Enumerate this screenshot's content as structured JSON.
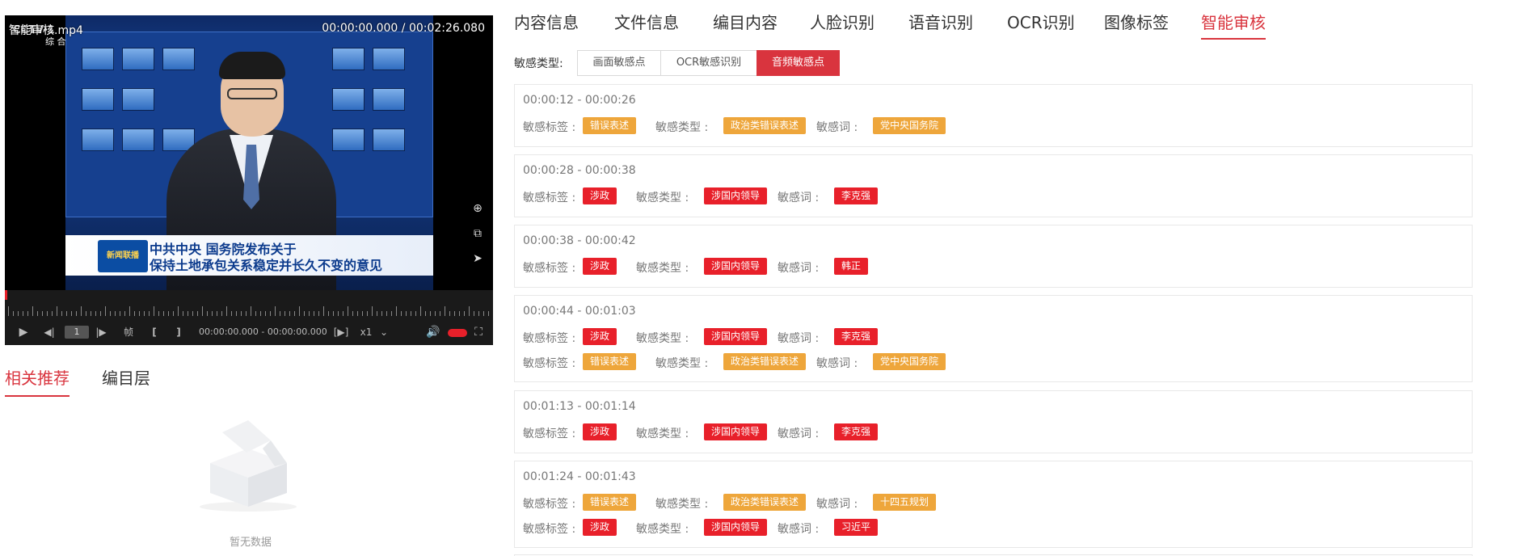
{
  "player": {
    "file_name": "智能审核.mp4",
    "time_display": "00:00:00.000 / 00:02:26.080",
    "channel_logo": "CCTV-1",
    "channel_sub": "综 合",
    "caption_logo": "新闻联播",
    "caption_line1": "中共中央 国务院发布关于",
    "caption_line2": "保持土地承包关系稳定并长久不变的意见",
    "frame_value": "1",
    "frame_label": "帧",
    "in_out_time": "00:00:00.000 - 00:00:00.000",
    "speed": "x1"
  },
  "left_tabs": [
    {
      "label": "相关推荐",
      "active": true
    },
    {
      "label": "编目层",
      "active": false
    }
  ],
  "empty_state": {
    "text": "暂无数据"
  },
  "main_tabs": [
    {
      "label": "内容信息"
    },
    {
      "label": "文件信息"
    },
    {
      "label": "编目内容"
    },
    {
      "label": "人脸识别"
    },
    {
      "label": "语音识别"
    },
    {
      "label": "OCR识别"
    },
    {
      "label": "图像标签"
    },
    {
      "label": "智能审核",
      "active": true
    }
  ],
  "filter": {
    "label": "敏感类型:",
    "options": [
      "画面敏感点",
      "OCR敏感识别",
      "音频敏感点"
    ],
    "selected": "音频敏感点"
  },
  "field_labels": {
    "tag": "敏感标签 :",
    "type": "敏感类型 :",
    "word": "敏感词 :"
  },
  "colors": {
    "accent": "#d9343e",
    "tag_orange": "#eea63b",
    "tag_red": "#e8202a"
  },
  "results": [
    {
      "time": "00:00:12 - 00:00:26",
      "rows": [
        {
          "tag": "错误表述",
          "type": "政治类错误表述",
          "word": "党中央国务院",
          "color": "orange"
        }
      ]
    },
    {
      "time": "00:00:28 - 00:00:38",
      "rows": [
        {
          "tag": "涉政",
          "type": "涉国内领导",
          "word": "李克强",
          "color": "red"
        }
      ]
    },
    {
      "time": "00:00:38 - 00:00:42",
      "rows": [
        {
          "tag": "涉政",
          "type": "涉国内领导",
          "word": "韩正",
          "color": "red"
        }
      ]
    },
    {
      "time": "00:00:44 - 00:01:03",
      "rows": [
        {
          "tag": "涉政",
          "type": "涉国内领导",
          "word": "李克强",
          "color": "red"
        },
        {
          "tag": "错误表述",
          "type": "政治类错误表述",
          "word": "党中央国务院",
          "color": "orange"
        }
      ]
    },
    {
      "time": "00:01:13 - 00:01:14",
      "rows": [
        {
          "tag": "涉政",
          "type": "涉国内领导",
          "word": "李克强",
          "color": "red"
        }
      ]
    },
    {
      "time": "00:01:24 - 00:01:43",
      "rows": [
        {
          "tag": "错误表述",
          "type": "政治类错误表述",
          "word": "十四五规划",
          "color": "orange"
        },
        {
          "tag": "涉政",
          "type": "涉国内领导",
          "word": "习近平",
          "color": "red"
        }
      ]
    }
  ]
}
